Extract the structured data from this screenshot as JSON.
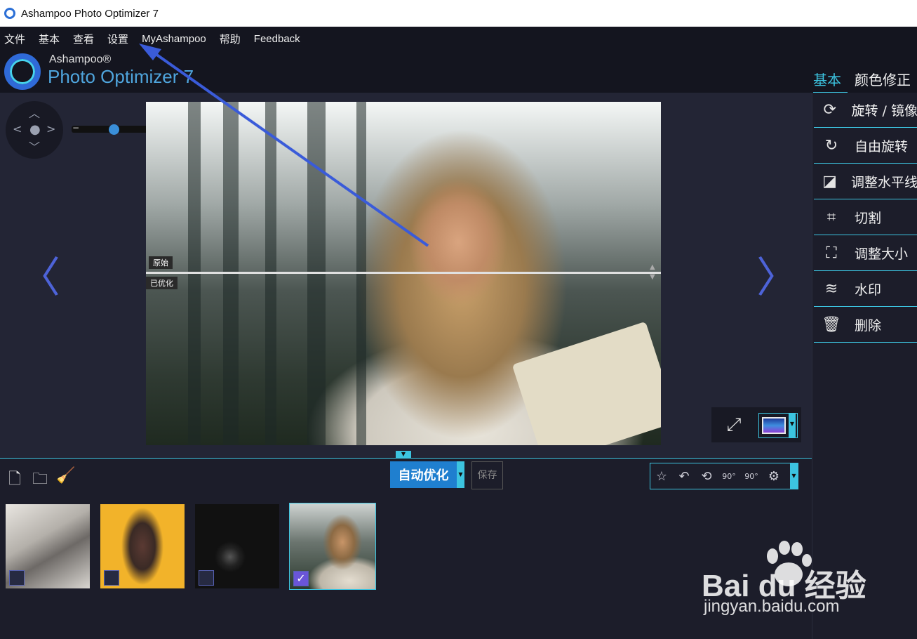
{
  "window": {
    "title": "Ashampoo Photo Optimizer 7"
  },
  "menu": {
    "items": [
      "文件",
      "基本",
      "查看",
      "设置",
      "MyAshampoo",
      "帮助",
      "Feedback"
    ]
  },
  "logo": {
    "brand": "Ashampoo®",
    "product": "Photo Optimizer 7"
  },
  "right_tabs": {
    "active": "基本",
    "inactive": "颜色修正"
  },
  "viewer": {
    "split_top_label": "原始",
    "split_bottom_label": "已优化"
  },
  "tools": [
    {
      "label": "旋转 / 镜像",
      "icon": "rotate-mirror-icon"
    },
    {
      "label": "自由旋转",
      "icon": "free-rotate-icon"
    },
    {
      "label": "调整水平线",
      "icon": "level-horizon-icon"
    },
    {
      "label": "切割",
      "icon": "crop-icon"
    },
    {
      "label": "调整大小",
      "icon": "resize-icon"
    },
    {
      "label": "水印",
      "icon": "watermark-icon"
    },
    {
      "label": "删除",
      "icon": "trash-icon"
    }
  ],
  "toolbar": {
    "auto_optimize_label": "自动优化",
    "save_label": "保存",
    "rotate_left_label": "90°",
    "rotate_right_label": "90°"
  },
  "watermark": {
    "logo": "Bai du 经验",
    "url": "jingyan.baidu.com"
  },
  "colors": {
    "accent": "#3cc4e0",
    "brand_blue": "#2f6ad8",
    "annotation": "#3a5bd9"
  }
}
